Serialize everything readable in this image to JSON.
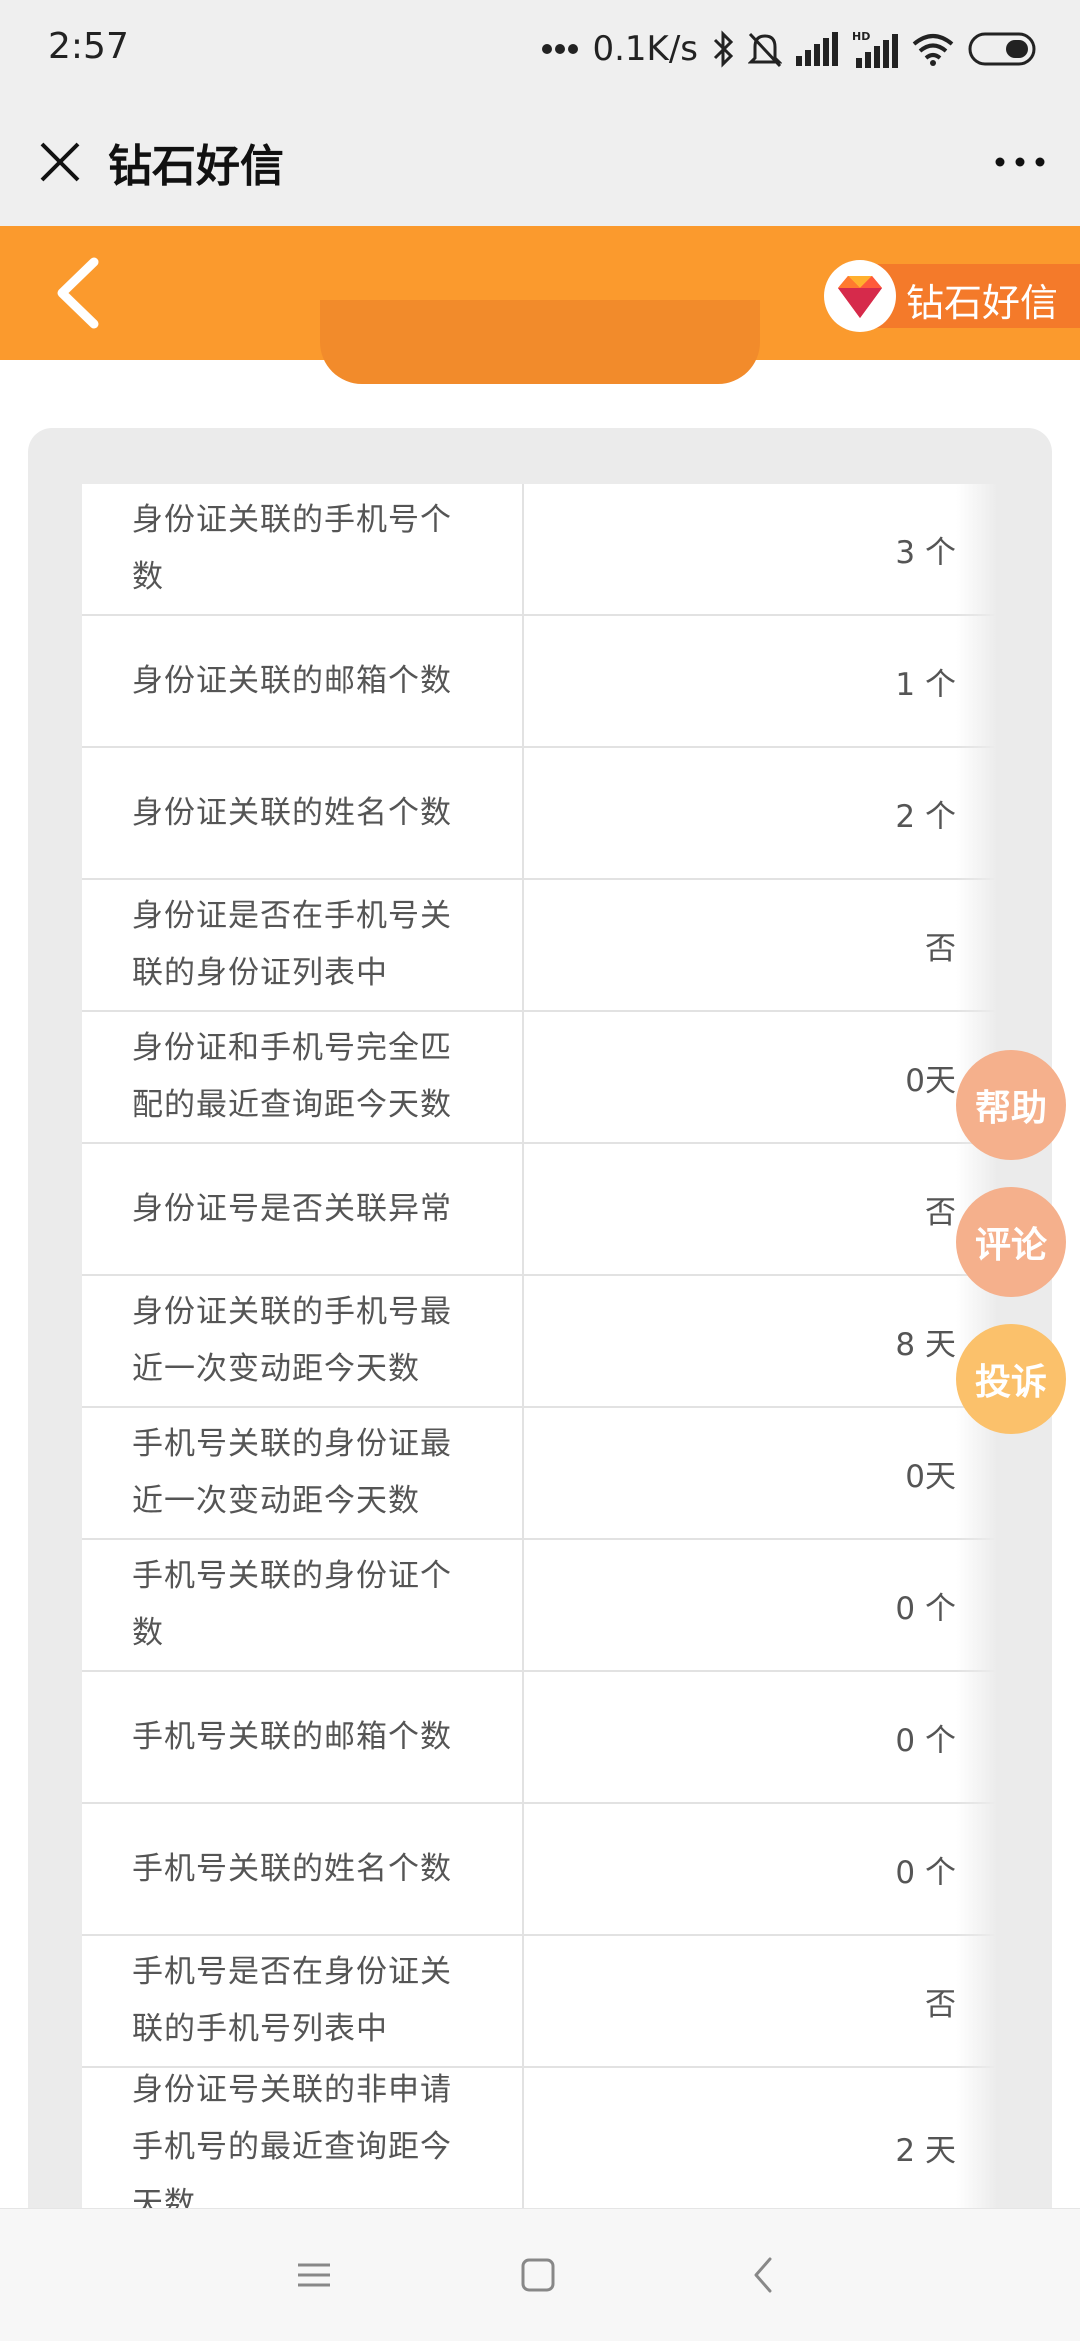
{
  "status_bar": {
    "time": "2:57",
    "network_speed": "0.1K/s",
    "icons": [
      "more-dots-icon",
      "bluetooth-icon",
      "mute-bell-icon",
      "signal-icon",
      "hd-signal-icon",
      "wifi-icon",
      "battery-icon"
    ]
  },
  "header": {
    "title": "钻石好信",
    "close_icon": "close-icon",
    "more_icon": "more-icon"
  },
  "banner": {
    "brand_text": "钻石好信",
    "back_icon": "chevron-left-icon",
    "logo_icon": "diamond-icon"
  },
  "table": {
    "rows": [
      {
        "label": "身份证关联的手机号个数",
        "value": "3 个"
      },
      {
        "label": "身份证关联的邮箱个数",
        "value": "1 个"
      },
      {
        "label": "身份证关联的姓名个数",
        "value": "2 个"
      },
      {
        "label": "身份证是否在手机号关联的身份证列表中",
        "value": "否"
      },
      {
        "label": "身份证和手机号完全匹配的最近查询距今天数",
        "value": "0天"
      },
      {
        "label": "身份证号是否关联异常",
        "value": "否"
      },
      {
        "label": "身份证关联的手机号最近一次变动距今天数",
        "value": "8 天"
      },
      {
        "label": "手机号关联的身份证最近一次变动距今天数",
        "value": "0天"
      },
      {
        "label": "手机号关联的身份证个数",
        "value": "0 个"
      },
      {
        "label": "手机号关联的邮箱个数",
        "value": "0 个"
      },
      {
        "label": "手机号关联的姓名个数",
        "value": "0 个"
      },
      {
        "label": "手机号是否在身份证关联的手机号列表中",
        "value": "否"
      },
      {
        "label": "身份证号关联的非申请手机号的最近查询距今天数",
        "value": "2 天"
      }
    ]
  },
  "floating_buttons": {
    "help": "帮助",
    "comment": "评论",
    "complaint": "投诉"
  },
  "colors": {
    "banner": "#fb9a2d",
    "brand_badge": "#f47a2a",
    "help": "#f5b08c",
    "comment": "#f5b08c",
    "complaint": "#fbc16b"
  },
  "nav_bar": {
    "icons": [
      "menu-icon",
      "home-square-icon",
      "back-triangle-icon"
    ]
  }
}
